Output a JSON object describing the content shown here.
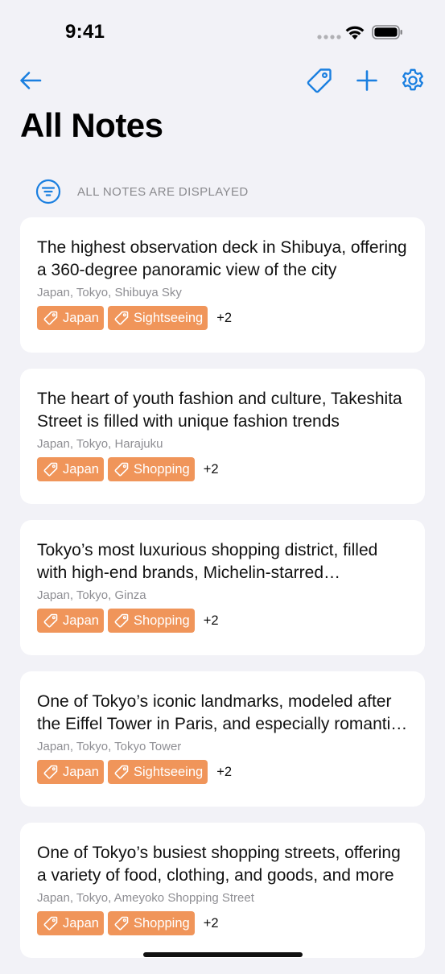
{
  "status_bar": {
    "time": "9:41"
  },
  "nav": {
    "back_icon": "arrow-left-icon",
    "tag_icon": "tag-icon",
    "add_icon": "plus-icon",
    "settings_icon": "gear-icon"
  },
  "title": "All Notes",
  "filter": {
    "label": "ALL NOTES ARE DISPLAYED",
    "icon": "filter-icon"
  },
  "colors": {
    "accent": "#1a7fe0",
    "tag_bg": "#f0955a",
    "background": "#f2f2f7",
    "card": "#ffffff"
  },
  "notes": [
    {
      "text": "The highest observation deck in Shibuya, offering a 360-degree panoramic view of the city",
      "location": "Japan, Tokyo, Shibuya Sky",
      "tags": [
        "Japan",
        "Sightseeing"
      ],
      "more": "+2"
    },
    {
      "text": "The heart of youth fashion and culture, Takeshita Street is filled with unique fashion trends",
      "location": "Japan, Tokyo, Harajuku",
      "tags": [
        "Japan",
        "Shopping"
      ],
      "more": "+2"
    },
    {
      "text": "Tokyo’s most luxurious shopping district, filled with high-end brands, Michelin-starred restaurants",
      "location": "Japan, Tokyo, Ginza",
      "tags": [
        "Japan",
        "Shopping"
      ],
      "more": "+2"
    },
    {
      "text": "One of Tokyo’s iconic landmarks, modeled after the Eiffel Tower in Paris, and especially romantic at night",
      "location": "Japan, Tokyo, Tokyo Tower",
      "tags": [
        "Japan",
        "Sightseeing"
      ],
      "more": "+2"
    },
    {
      "text": "One of Tokyo’s busiest shopping streets, offering a variety of food, clothing, and goods, and more",
      "location": "Japan, Tokyo, Ameyoko Shopping Street",
      "tags": [
        "Japan",
        "Shopping"
      ],
      "more": "+2"
    }
  ]
}
